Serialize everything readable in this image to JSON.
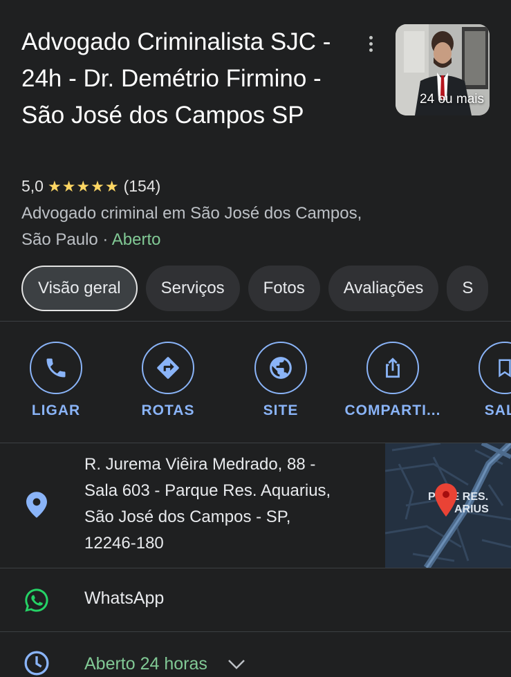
{
  "header": {
    "title": "Advogado Criminalista SJC - 24h - Dr. Demétrio Firmino - São José dos Campos SP",
    "photo_count": "24 ou mais"
  },
  "rating": {
    "score": "5,0",
    "stars": "★★★★★",
    "reviews": "(154)"
  },
  "category": {
    "text": "Advogado criminal em São José dos Campos, São Paulo",
    "separator": " · ",
    "status": "Aberto"
  },
  "tabs": [
    {
      "label": "Visão geral"
    },
    {
      "label": "Serviços"
    },
    {
      "label": "Fotos"
    },
    {
      "label": "Avaliações"
    },
    {
      "label": "S"
    }
  ],
  "actions": [
    {
      "label": "LIGAR",
      "icon": "phone-icon"
    },
    {
      "label": "ROTAS",
      "icon": "directions-icon"
    },
    {
      "label": "SITE",
      "icon": "globe-icon"
    },
    {
      "label": "COMPARTI...",
      "icon": "share-icon"
    },
    {
      "label": "SALV",
      "icon": "bookmark-icon"
    }
  ],
  "address": {
    "line1": "R. Jurema Viêira Medrado, 88 -",
    "line2": "Sala 603 - Parque Res. Aquarius,",
    "line3": "São José dos Campos - SP,",
    "line4": "12246-180",
    "map_label_1": "PQUE RES.",
    "map_label_2": "ARIUS"
  },
  "whatsapp": {
    "label": "WhatsApp"
  },
  "hours": {
    "label": "Aberto 24 horas"
  },
  "colors": {
    "background": "#1f2021",
    "accent": "#8ab4f8",
    "open": "#81c995",
    "star": "#fdd663",
    "pin": "#ea4335",
    "whatsapp": "#25d366"
  }
}
